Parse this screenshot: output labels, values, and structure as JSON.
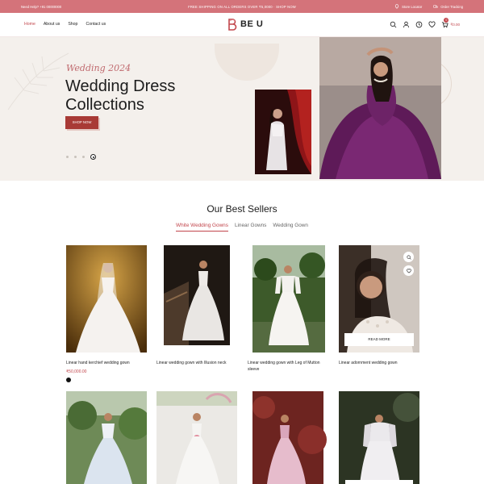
{
  "topbar": {
    "help": "Need Help? +91 00000000",
    "promo": "FREE SHIPPING ON ALL ORDERS OVER ₹5,0000 · SHOP NOW",
    "store_locator": "Store Locator",
    "order_tracking": "Order Tracking"
  },
  "nav": {
    "items": [
      "Home",
      "About us",
      "Shop",
      "Contact us"
    ]
  },
  "brand": {
    "name": "BE U"
  },
  "cart": {
    "count": "0",
    "amount": "₹0.00"
  },
  "hero": {
    "script": "Wedding 2024",
    "title": "Wedding Dress Collections",
    "button": "SHOP NOW",
    "slide_count": 4,
    "active_slide": 4
  },
  "best_sellers": {
    "title": "Our Best Sellers",
    "tabs": [
      "White Wedding Gowns",
      "Linear Gowns",
      "Wedding Gown"
    ],
    "active_tab": 0,
    "read_more": "READ MORE",
    "products": [
      {
        "name": "Linear hand kerchief wedding gown",
        "price": "₹50,000.00"
      },
      {
        "name": "Linear wedding gown with Illusion neck",
        "price": ""
      },
      {
        "name": "Linear wedding gown with Leg of Mutton sleeve",
        "price": ""
      },
      {
        "name": "Linear adornment wedding gown",
        "price": ""
      }
    ]
  },
  "colors": {
    "accent": "#c2464c",
    "topbar": "#d4737a",
    "button": "#a83a36",
    "hero_bg": "#f4f0ec"
  }
}
